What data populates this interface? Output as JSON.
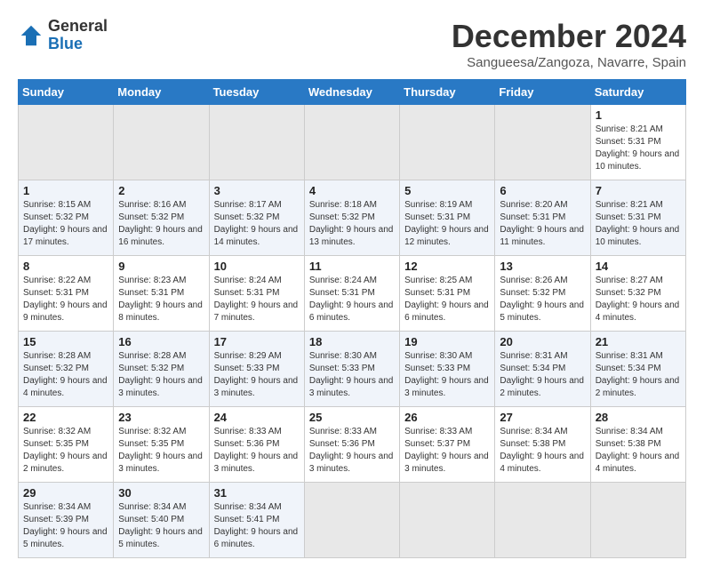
{
  "header": {
    "logo_general": "General",
    "logo_blue": "Blue",
    "title": "December 2024",
    "location": "Sangueesa/Zangoza, Navarre, Spain"
  },
  "calendar": {
    "days_of_week": [
      "Sunday",
      "Monday",
      "Tuesday",
      "Wednesday",
      "Thursday",
      "Friday",
      "Saturday"
    ],
    "weeks": [
      [
        {
          "day": "",
          "empty": true
        },
        {
          "day": "",
          "empty": true
        },
        {
          "day": "",
          "empty": true
        },
        {
          "day": "",
          "empty": true
        },
        {
          "day": "",
          "empty": true
        },
        {
          "day": "",
          "empty": true
        },
        {
          "day": "1",
          "sunrise": "Sunrise: 8:21 AM",
          "sunset": "Sunset: 5:31 PM",
          "daylight": "Daylight: 9 hours and 10 minutes."
        }
      ],
      [
        {
          "day": "1",
          "sunrise": "Sunrise: 8:15 AM",
          "sunset": "Sunset: 5:32 PM",
          "daylight": "Daylight: 9 hours and 17 minutes."
        },
        {
          "day": "2",
          "sunrise": "Sunrise: 8:16 AM",
          "sunset": "Sunset: 5:32 PM",
          "daylight": "Daylight: 9 hours and 16 minutes."
        },
        {
          "day": "3",
          "sunrise": "Sunrise: 8:17 AM",
          "sunset": "Sunset: 5:32 PM",
          "daylight": "Daylight: 9 hours and 14 minutes."
        },
        {
          "day": "4",
          "sunrise": "Sunrise: 8:18 AM",
          "sunset": "Sunset: 5:32 PM",
          "daylight": "Daylight: 9 hours and 13 minutes."
        },
        {
          "day": "5",
          "sunrise": "Sunrise: 8:19 AM",
          "sunset": "Sunset: 5:31 PM",
          "daylight": "Daylight: 9 hours and 12 minutes."
        },
        {
          "day": "6",
          "sunrise": "Sunrise: 8:20 AM",
          "sunset": "Sunset: 5:31 PM",
          "daylight": "Daylight: 9 hours and 11 minutes."
        },
        {
          "day": "7",
          "sunrise": "Sunrise: 8:21 AM",
          "sunset": "Sunset: 5:31 PM",
          "daylight": "Daylight: 9 hours and 10 minutes."
        }
      ],
      [
        {
          "day": "8",
          "sunrise": "Sunrise: 8:22 AM",
          "sunset": "Sunset: 5:31 PM",
          "daylight": "Daylight: 9 hours and 9 minutes."
        },
        {
          "day": "9",
          "sunrise": "Sunrise: 8:23 AM",
          "sunset": "Sunset: 5:31 PM",
          "daylight": "Daylight: 9 hours and 8 minutes."
        },
        {
          "day": "10",
          "sunrise": "Sunrise: 8:24 AM",
          "sunset": "Sunset: 5:31 PM",
          "daylight": "Daylight: 9 hours and 7 minutes."
        },
        {
          "day": "11",
          "sunrise": "Sunrise: 8:24 AM",
          "sunset": "Sunset: 5:31 PM",
          "daylight": "Daylight: 9 hours and 6 minutes."
        },
        {
          "day": "12",
          "sunrise": "Sunrise: 8:25 AM",
          "sunset": "Sunset: 5:31 PM",
          "daylight": "Daylight: 9 hours and 6 minutes."
        },
        {
          "day": "13",
          "sunrise": "Sunrise: 8:26 AM",
          "sunset": "Sunset: 5:32 PM",
          "daylight": "Daylight: 9 hours and 5 minutes."
        },
        {
          "day": "14",
          "sunrise": "Sunrise: 8:27 AM",
          "sunset": "Sunset: 5:32 PM",
          "daylight": "Daylight: 9 hours and 4 minutes."
        }
      ],
      [
        {
          "day": "15",
          "sunrise": "Sunrise: 8:28 AM",
          "sunset": "Sunset: 5:32 PM",
          "daylight": "Daylight: 9 hours and 4 minutes."
        },
        {
          "day": "16",
          "sunrise": "Sunrise: 8:28 AM",
          "sunset": "Sunset: 5:32 PM",
          "daylight": "Daylight: 9 hours and 3 minutes."
        },
        {
          "day": "17",
          "sunrise": "Sunrise: 8:29 AM",
          "sunset": "Sunset: 5:33 PM",
          "daylight": "Daylight: 9 hours and 3 minutes."
        },
        {
          "day": "18",
          "sunrise": "Sunrise: 8:30 AM",
          "sunset": "Sunset: 5:33 PM",
          "daylight": "Daylight: 9 hours and 3 minutes."
        },
        {
          "day": "19",
          "sunrise": "Sunrise: 8:30 AM",
          "sunset": "Sunset: 5:33 PM",
          "daylight": "Daylight: 9 hours and 3 minutes."
        },
        {
          "day": "20",
          "sunrise": "Sunrise: 8:31 AM",
          "sunset": "Sunset: 5:34 PM",
          "daylight": "Daylight: 9 hours and 2 minutes."
        },
        {
          "day": "21",
          "sunrise": "Sunrise: 8:31 AM",
          "sunset": "Sunset: 5:34 PM",
          "daylight": "Daylight: 9 hours and 2 minutes."
        }
      ],
      [
        {
          "day": "22",
          "sunrise": "Sunrise: 8:32 AM",
          "sunset": "Sunset: 5:35 PM",
          "daylight": "Daylight: 9 hours and 2 minutes."
        },
        {
          "day": "23",
          "sunrise": "Sunrise: 8:32 AM",
          "sunset": "Sunset: 5:35 PM",
          "daylight": "Daylight: 9 hours and 3 minutes."
        },
        {
          "day": "24",
          "sunrise": "Sunrise: 8:33 AM",
          "sunset": "Sunset: 5:36 PM",
          "daylight": "Daylight: 9 hours and 3 minutes."
        },
        {
          "day": "25",
          "sunrise": "Sunrise: 8:33 AM",
          "sunset": "Sunset: 5:36 PM",
          "daylight": "Daylight: 9 hours and 3 minutes."
        },
        {
          "day": "26",
          "sunrise": "Sunrise: 8:33 AM",
          "sunset": "Sunset: 5:37 PM",
          "daylight": "Daylight: 9 hours and 3 minutes."
        },
        {
          "day": "27",
          "sunrise": "Sunrise: 8:34 AM",
          "sunset": "Sunset: 5:38 PM",
          "daylight": "Daylight: 9 hours and 4 minutes."
        },
        {
          "day": "28",
          "sunrise": "Sunrise: 8:34 AM",
          "sunset": "Sunset: 5:38 PM",
          "daylight": "Daylight: 9 hours and 4 minutes."
        }
      ],
      [
        {
          "day": "29",
          "sunrise": "Sunrise: 8:34 AM",
          "sunset": "Sunset: 5:39 PM",
          "daylight": "Daylight: 9 hours and 5 minutes."
        },
        {
          "day": "30",
          "sunrise": "Sunrise: 8:34 AM",
          "sunset": "Sunset: 5:40 PM",
          "daylight": "Daylight: 9 hours and 5 minutes."
        },
        {
          "day": "31",
          "sunrise": "Sunrise: 8:34 AM",
          "sunset": "Sunset: 5:41 PM",
          "daylight": "Daylight: 9 hours and 6 minutes."
        },
        {
          "day": "",
          "empty": true
        },
        {
          "day": "",
          "empty": true
        },
        {
          "day": "",
          "empty": true
        },
        {
          "day": "",
          "empty": true
        }
      ]
    ]
  }
}
